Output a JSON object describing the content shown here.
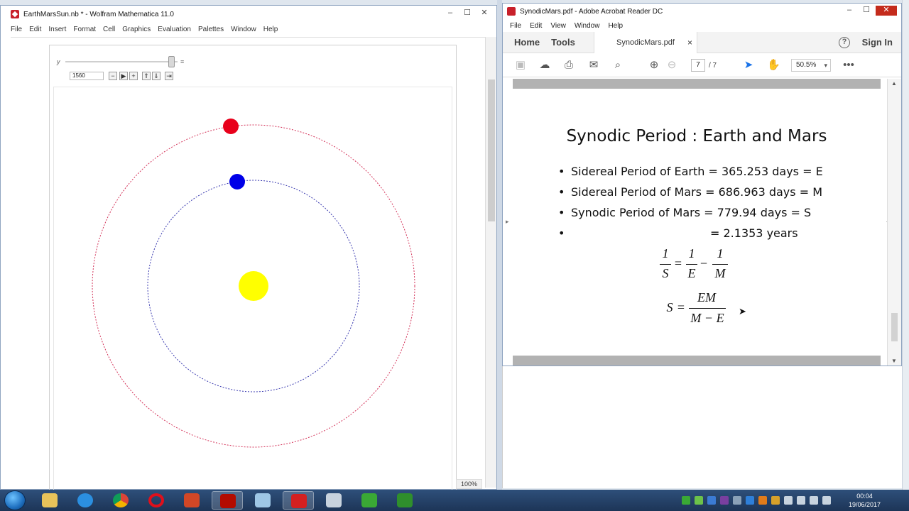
{
  "mathematica": {
    "title": "EarthMarsSun.nb * - Wolfram Mathematica 11.0",
    "menu": [
      "File",
      "Edit",
      "Insert",
      "Format",
      "Cell",
      "Graphics",
      "Evaluation",
      "Palettes",
      "Window",
      "Help"
    ],
    "slider_label": "y",
    "slider_value": "1560",
    "slider_fraction": 0.97,
    "zoom": "100%",
    "controls": [
      "−",
      "▶",
      "+",
      "⇑",
      "⇓",
      "⇥"
    ],
    "colors": {
      "mars": "#e8001b",
      "earth": "#0000e8",
      "sun": "#ffff00",
      "mars_orbit": "#d4345a",
      "earth_orbit": "#3a3ab0"
    }
  },
  "acrobat": {
    "title": "SynodicMars.pdf - Adobe Acrobat Reader DC",
    "menu": [
      "File",
      "Edit",
      "View",
      "Window",
      "Help"
    ],
    "tabs": {
      "home": "Home",
      "tools": "Tools",
      "document": "SynodicMars.pdf",
      "close": "×"
    },
    "help": "?",
    "sign_in": "Sign In",
    "page_current": "7",
    "page_total": "/ 7",
    "zoom": "50.5%",
    "slide": {
      "title": "Synodic Period : Earth and Mars",
      "bullets": [
        "Sidereal Period of Earth = 365.253 days = E",
        "Sidereal Period of Mars = 686.963 days = M",
        "Synodic Period of Mars = 779.94 days = S",
        "= 2.1353 years"
      ],
      "eq1": {
        "lhs_num": "1",
        "lhs_den": "S",
        "eq": "=",
        "a_num": "1",
        "a_den": "E",
        "minus": "−",
        "b_num": "1",
        "b_den": "M"
      },
      "eq2": {
        "lhs": "S",
        "eq": "=",
        "num": "EM",
        "den": "M − E"
      }
    }
  },
  "taskbar": {
    "clock_time": "00:04",
    "clock_date": "19/06/2017"
  }
}
